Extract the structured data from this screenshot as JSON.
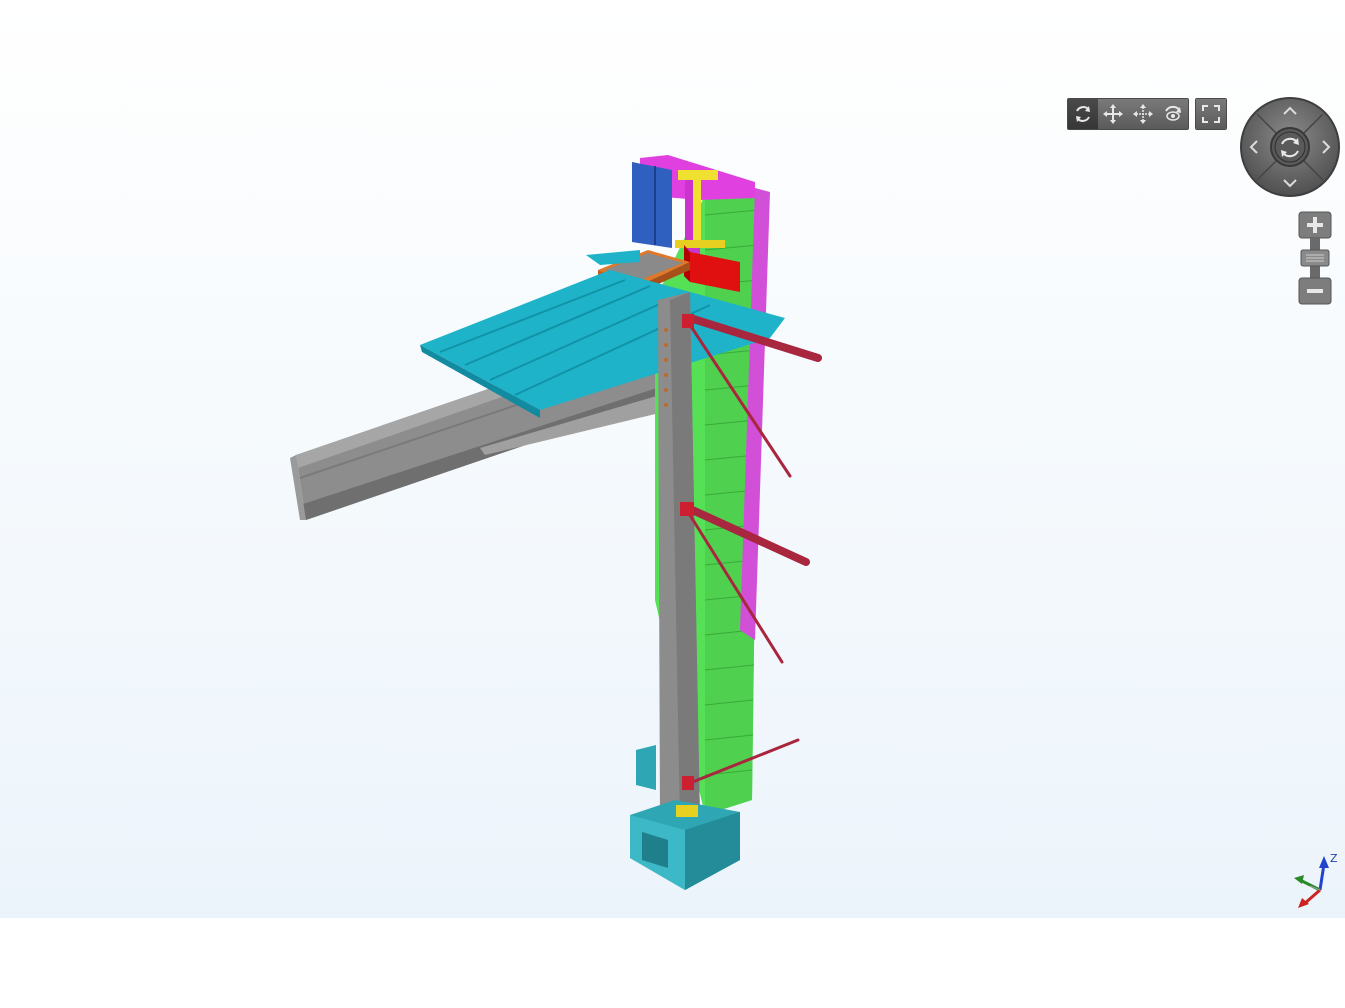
{
  "viewer": {
    "toolbar": {
      "icons": [
        "orbit-icon",
        "pan-icon",
        "move-icon",
        "look-around-icon",
        "fullscreen-icon"
      ]
    },
    "navigation_wheel": {
      "icons": [
        "arrow-up-icon",
        "arrow-down-icon",
        "arrow-left-icon",
        "arrow-right-icon",
        "rotate-center-icon"
      ]
    },
    "zoom_slider": {
      "icons": [
        "zoom-in-icon",
        "zoom-out-icon"
      ]
    },
    "axis_triad": {
      "z_label": "Z"
    },
    "colors": {
      "steel": "#8c8c8c",
      "deck": "#1eb3c8",
      "panel_green": "#55e055",
      "cladding_magenta": "#d24fd8",
      "brace_red": "#a8263e",
      "concrete": "#2ea6b4",
      "blue_panel": "#2f5fbf",
      "orange_plate": "#e0782a"
    }
  }
}
